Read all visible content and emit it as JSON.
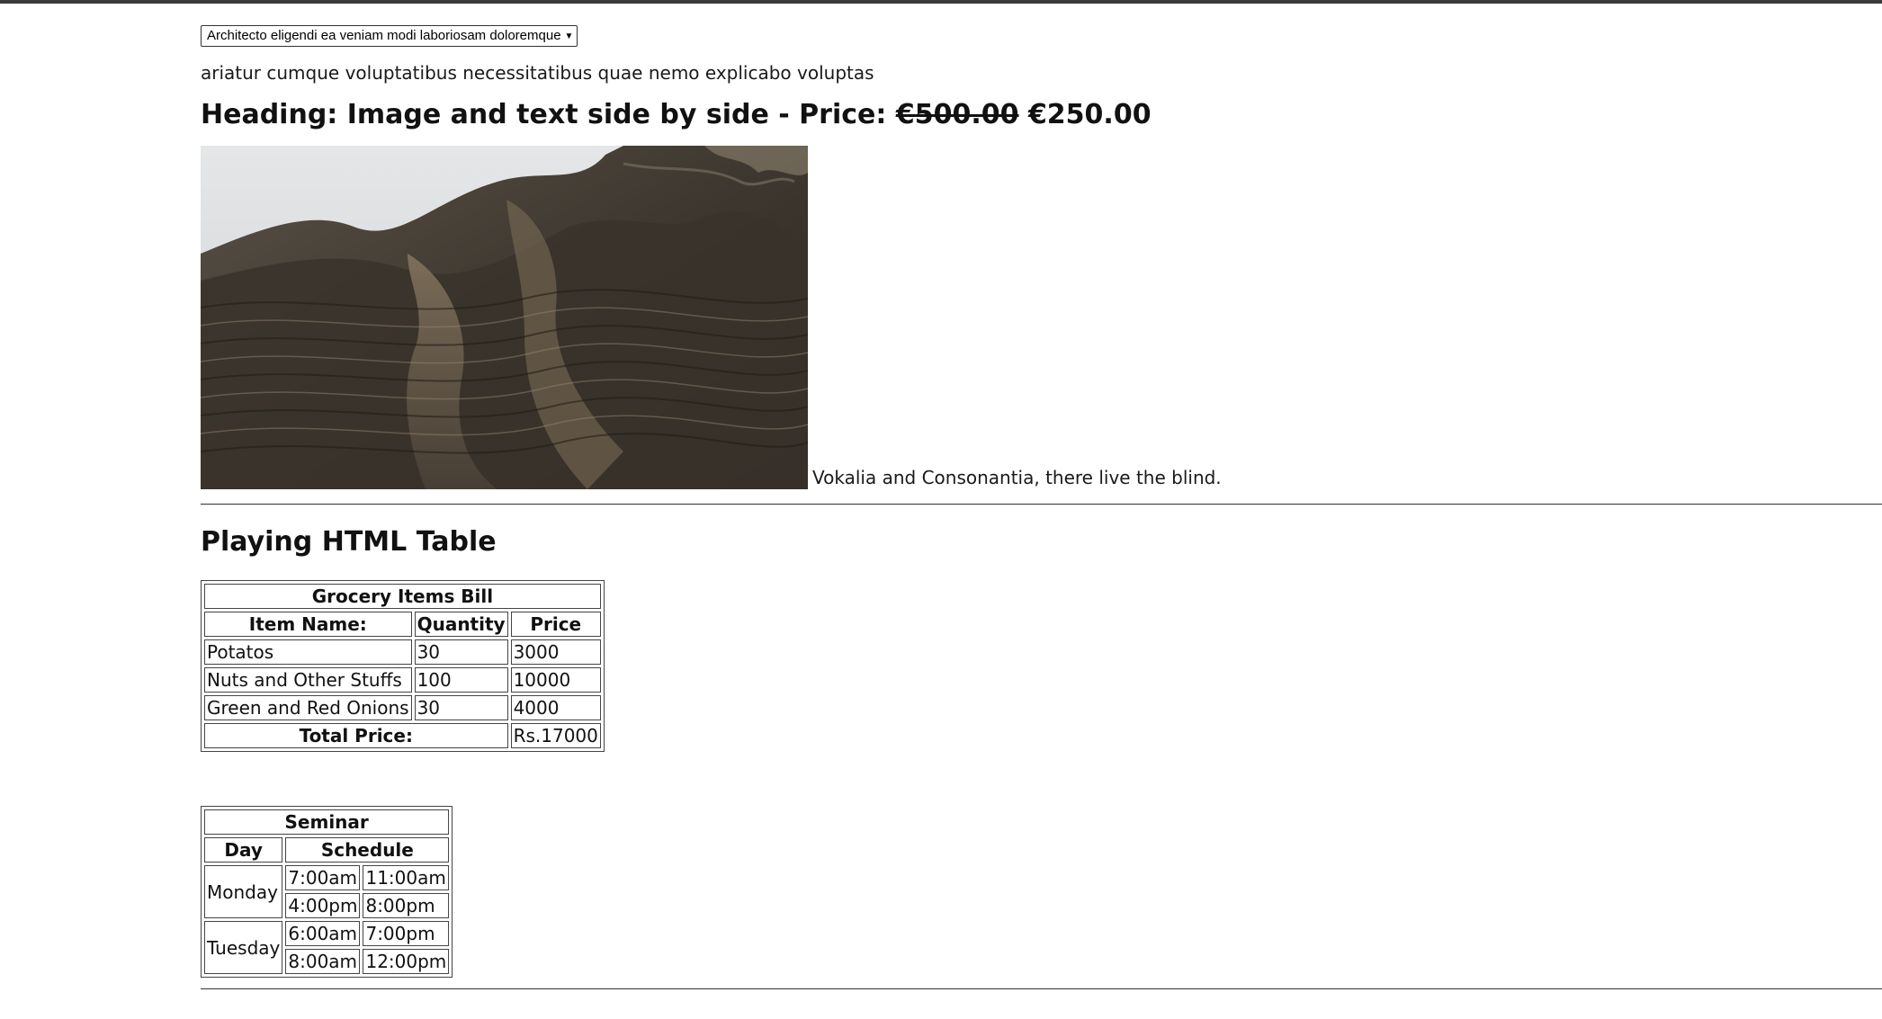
{
  "dropdown": {
    "selected": "Architecto eligendi ea veniam modi laboriosam doloremque"
  },
  "intro_text": "ariatur cumque voluptatibus necessitatibus quae nemo explicabo voluptas",
  "heading": {
    "prefix": "Heading: Image and text side by side - Price:",
    "old_price": "€500.00",
    "new_price": "€250.00"
  },
  "image_caption": "Vokalia and Consonantia, there live the blind.",
  "table_section_title": "Playing HTML Table",
  "grocery_table": {
    "caption": "Grocery Items Bill",
    "headers": [
      "Item Name:",
      "Quantity",
      "Price"
    ],
    "rows": [
      [
        "Potatos",
        "30",
        "3000"
      ],
      [
        "Nuts and Other Stuffs",
        "100",
        "10000"
      ],
      [
        "Green and Red Onions",
        "30",
        "4000"
      ]
    ],
    "total_label": "Total Price:",
    "total_value": "Rs.17000"
  },
  "seminar_table": {
    "caption": "Seminar",
    "headers": [
      "Day",
      "Schedule"
    ],
    "days": [
      {
        "day": "Monday",
        "slots": [
          [
            "7:00am",
            "11:00am"
          ],
          [
            "4:00pm",
            "8:00pm"
          ]
        ]
      },
      {
        "day": "Tuesday",
        "slots": [
          [
            "6:00am",
            "7:00pm"
          ],
          [
            "8:00am",
            "12:00pm"
          ]
        ]
      }
    ]
  },
  "colors": {
    "top_bar": "#3b3b3b",
    "text": "#111111",
    "border": "#444444",
    "background": "#ffffff"
  },
  "icons": {
    "dropdown": "chevron-down-icon"
  }
}
